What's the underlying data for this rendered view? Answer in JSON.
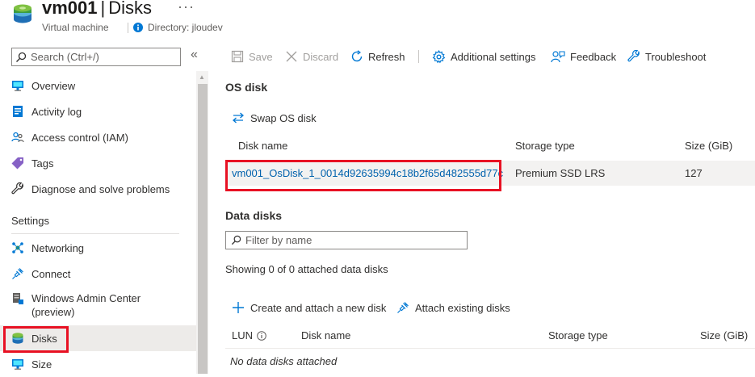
{
  "header": {
    "vm_name": "vm001",
    "separator": "|",
    "page_name": "Disks",
    "resource_type": "Virtual machine",
    "directory": "Directory: jloudev",
    "more": "···"
  },
  "sidebar": {
    "search_placeholder": "Search (Ctrl+/)",
    "collapse": "«",
    "items": [
      {
        "label": "Overview",
        "icon": "monitor-icon"
      },
      {
        "label": "Activity log",
        "icon": "activity-log-icon"
      },
      {
        "label": "Access control (IAM)",
        "icon": "people-icon"
      },
      {
        "label": "Tags",
        "icon": "tag-icon"
      },
      {
        "label": "Diagnose and solve problems",
        "icon": "wrench-icon"
      }
    ],
    "settings_label": "Settings",
    "settings_items": [
      {
        "label": "Networking",
        "icon": "network-icon"
      },
      {
        "label": "Connect",
        "icon": "plug-icon"
      },
      {
        "label": "Windows Admin Center\n(preview)",
        "icon": "admin-center-icon"
      },
      {
        "label": "Disks",
        "icon": "disk-icon",
        "active": true
      },
      {
        "label": "Size",
        "icon": "monitor-icon"
      }
    ]
  },
  "toolbar": {
    "save": "Save",
    "discard": "Discard",
    "refresh": "Refresh",
    "additional_settings": "Additional settings",
    "feedback": "Feedback",
    "troubleshoot": "Troubleshoot"
  },
  "os_disk": {
    "heading": "OS disk",
    "swap": "Swap OS disk",
    "columns": {
      "name": "Disk name",
      "storage": "Storage type",
      "size": "Size (GiB)"
    },
    "row": {
      "name": "vm001_OsDisk_1_0014d92635994c18b2f65d482555d77c",
      "storage": "Premium SSD LRS",
      "size": "127"
    }
  },
  "data_disks": {
    "heading": "Data disks",
    "filter_placeholder": "Filter by name",
    "showing": "Showing 0 of 0 attached data disks",
    "create_attach": "Create and attach a new disk",
    "attach_existing": "Attach existing disks",
    "columns": {
      "lun": "LUN",
      "name": "Disk name",
      "storage": "Storage type",
      "size": "Size (GiB)"
    },
    "empty": "No data disks attached"
  },
  "colors": {
    "accent": "#0078d4",
    "link": "#0062ad",
    "highlight": "#e81123"
  }
}
